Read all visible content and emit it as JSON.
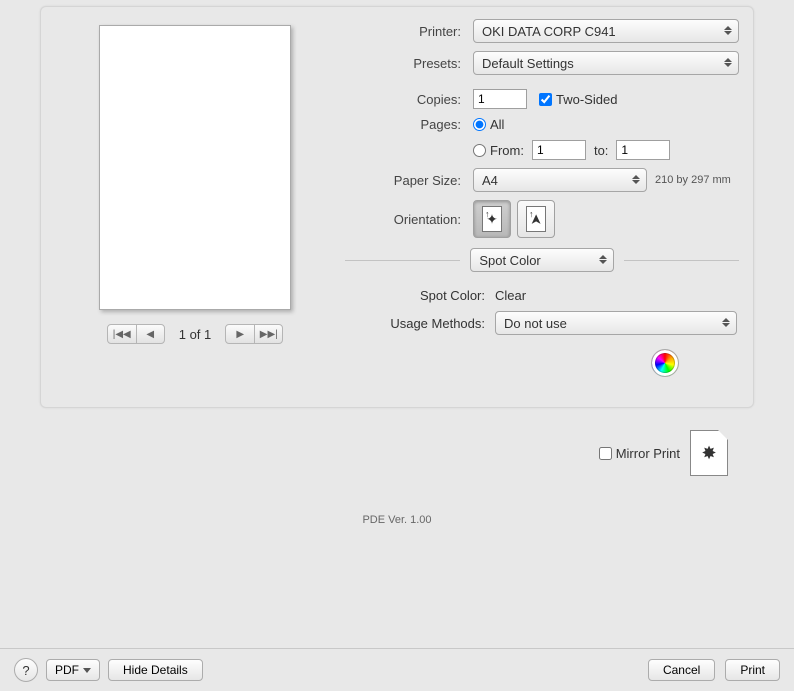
{
  "labels": {
    "printer": "Printer:",
    "presets": "Presets:",
    "copies": "Copies:",
    "two_sided": "Two-Sided",
    "pages": "Pages:",
    "all": "All",
    "from": "From:",
    "to": "to:",
    "paper_size": "Paper Size:",
    "orientation": "Orientation:",
    "spot_color": "Spot Color:",
    "usage_methods": "Usage Methods:",
    "mirror_print": "Mirror Print"
  },
  "values": {
    "printer": "OKI DATA CORP C941",
    "preset": "Default Settings",
    "copies": "1",
    "page_from": "1",
    "page_to": "1",
    "paper_size": "A4",
    "paper_dim": "210 by 297 mm",
    "section_dropdown": "Spot Color",
    "spot_color_value": "Clear",
    "usage_method": "Do not use",
    "pager": "1 of 1",
    "pde_ver": "PDE Ver.  1.00"
  },
  "footer": {
    "pdf": "PDF",
    "hide_details": "Hide Details",
    "cancel": "Cancel",
    "print": "Print"
  }
}
